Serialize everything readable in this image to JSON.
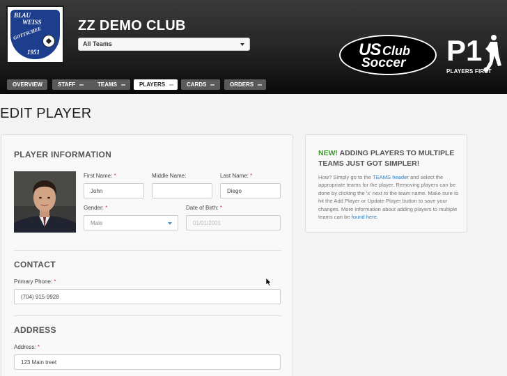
{
  "header": {
    "club_name": "ZZ DEMO CLUB",
    "team_select": "All Teams",
    "logo": {
      "line1": "BLAU",
      "line2": "WEISS",
      "line3": "GOTTSCHEE",
      "year": "1951"
    },
    "us_club_soccer": {
      "us": "US",
      "club": "Club",
      "soccer": "Soccer"
    },
    "p1_mark": "P1",
    "players_first": "PLAYERS FIRST"
  },
  "nav": [
    {
      "label": "OVERVIEW",
      "dropdown": false
    },
    {
      "label": "STAFF",
      "dropdown": true
    },
    {
      "label": "TEAMS",
      "dropdown": true
    },
    {
      "label": "PLAYERS",
      "dropdown": true,
      "active": true
    },
    {
      "label": "CARDS",
      "dropdown": true
    },
    {
      "label": "ORDERS",
      "dropdown": true
    }
  ],
  "page_title": "EDIT PLAYER",
  "player_info": {
    "heading": "PLAYER INFORMATION",
    "first_name_label": "First Name:",
    "first_name": "John",
    "middle_name_label": "Middle Name:",
    "middle_name": "",
    "last_name_label": "Last Name:",
    "last_name": "Diego",
    "gender_label": "Gender:",
    "gender": "Male",
    "dob_label": "Date of Birth:",
    "dob": "01/01/2001"
  },
  "contact": {
    "heading": "CONTACT",
    "phone_label": "Primary Phone:",
    "phone": "(704) 915-9928"
  },
  "address": {
    "heading": "ADDRESS",
    "address_label": "Address:",
    "address": "123 Main treet"
  },
  "required_mark": "*",
  "side": {
    "new": "NEW!",
    "title": "ADDING PLAYERS TO MULTIPLE TEAMS JUST GOT SIMPLER!",
    "body1": "How? Simply go to the ",
    "link1": "TEAMS header",
    "body2": " and select the appropriate teams for the player. Removing players can be done by clicking the 'x' next to the team name. Make sure to hit the Add Player or Update Player button to save your changes. More information about adding players to multiple teams can be ",
    "link2": "found here",
    "body3": "."
  },
  "colors": {
    "accent_green": "#3c9b2c",
    "link_blue": "#2f7fc3",
    "required_red": "#dd3333"
  }
}
